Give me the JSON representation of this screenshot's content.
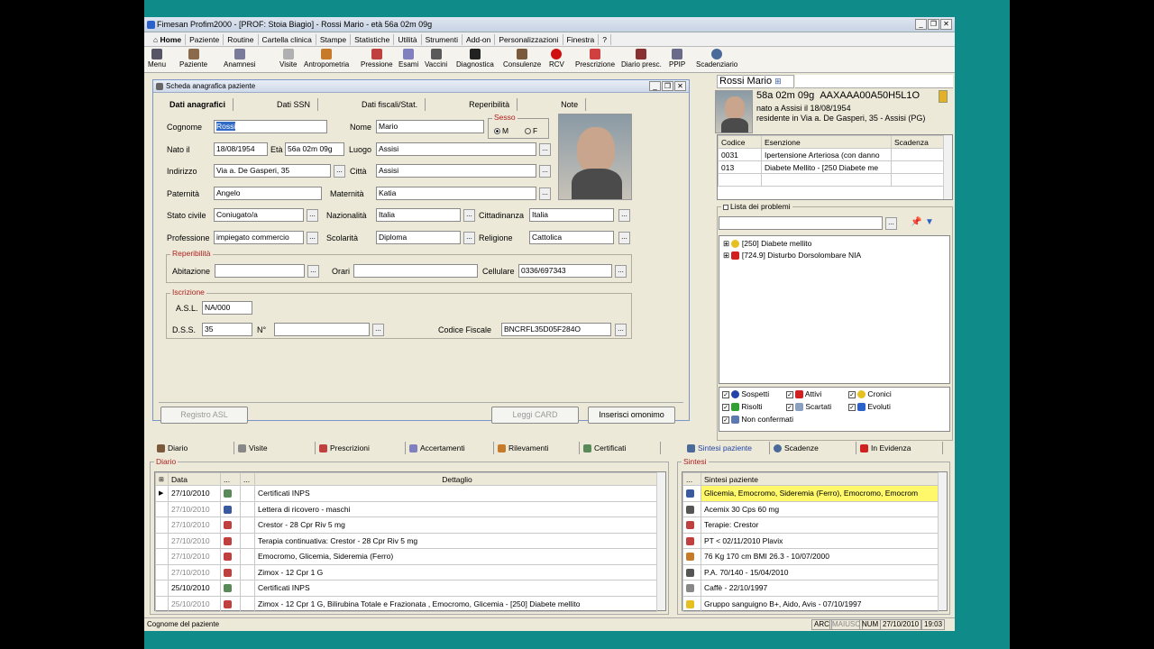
{
  "window": {
    "title": "Fimesan Profim2000 - [PROF: Stoia Biagio] - Rossi Mario - età 56a 02m 09g"
  },
  "menu": [
    "Home",
    "Paziente",
    "Routine",
    "Cartella clinica",
    "Stampe",
    "Statistiche",
    "Utilità",
    "Strumenti",
    "Add-on",
    "Personalizzazioni",
    "Finestra",
    "?"
  ],
  "toolbar": [
    "Menu",
    "Paziente",
    "Anamnesi",
    "Visite",
    "Antropometria",
    "Pressione",
    "Esami",
    "Vaccini",
    "Diagnostica",
    "Consulenze",
    "RCV",
    "Prescrizione",
    "Diario presc.",
    "PPIP",
    "Scadenziario"
  ],
  "form": {
    "title": "Scheda anagrafica paziente",
    "tabs": [
      "Dati anagrafici",
      "Dati SSN",
      "Dati fiscali/Stat.",
      "Reperibilità",
      "Note"
    ],
    "labels": {
      "cognome": "Cognome",
      "nome": "Nome",
      "sesso": "Sesso",
      "m": "M",
      "f": "F",
      "nato": "Nato il",
      "eta": "Età",
      "luogo": "Luogo",
      "indirizzo": "Indirizzo",
      "citta": "Città",
      "paternita": "Paternità",
      "maternita": "Maternità",
      "stato": "Stato civile",
      "naz": "Nazionalità",
      "citt": "Cittadinanza",
      "prof": "Professione",
      "scol": "Scolarità",
      "rel": "Religione",
      "reper": "Reperibilità",
      "abit": "Abitazione",
      "orari": "Orari",
      "cell": "Cellulare",
      "iscr": "Iscrizione",
      "asl": "A.S.L.",
      "dss": "D.S.S.",
      "n": "N°",
      "cf": "Codice Fiscale"
    },
    "values": {
      "cognome": "Rossi",
      "nome": "Mario",
      "nato": "18/08/1954",
      "eta": "56a 02m 09g",
      "luogo": "Assisi",
      "indirizzo": "Via a. De Gasperi, 35",
      "citta": "Assisi",
      "paternita": "Angelo",
      "maternita": "Katia",
      "stato": "Coniugato/a",
      "naz": "Italia",
      "citt": "Italia",
      "prof": "impiegato commercio",
      "scol": "Diploma",
      "rel": "Cattolica",
      "abit": "",
      "orari": "",
      "cell": "0336/697343",
      "asl": "NA/000",
      "dss": "35",
      "n": "",
      "cf": "BNCRFL35D05F284O"
    },
    "buttons": {
      "registro": "Registro ASL",
      "card": "Leggi CARD",
      "omonimo": "Inserisci omonimo"
    }
  },
  "patient": {
    "name": "Rossi Mario",
    "age": "58a 02m 09g",
    "code": "AAXAAA00A50H5L1O",
    "born": "nato a Assisi il 18/08/1954",
    "resid": "residente in Via a. De Gasperi, 35 - Assisi (PG)",
    "ex_headers": [
      "Codice",
      "Esenzione",
      "Scadenza"
    ],
    "exemptions": [
      [
        "0031",
        "Ipertensione Arteriosa (con danno",
        ""
      ],
      [
        "013",
        "Diabete Mellito - [250 Diabete me",
        ""
      ]
    ],
    "problems_title": "Lista dei problemi",
    "problems": [
      "[250] Diabete mellito",
      "[724.9] Disturbo Dorsolombare NIA"
    ],
    "filters": [
      "Sospetti",
      "Attivi",
      "Cronici",
      "Risolti",
      "Scartati",
      "Evoluti",
      "Non confermati"
    ]
  },
  "bottom_tabs": [
    "Diario",
    "Visite",
    "Prescrizioni",
    "Accertamenti",
    "Rilevamenti",
    "Certificati"
  ],
  "right_tabs": [
    "Sintesi paziente",
    "Scadenze",
    "In Evidenza"
  ],
  "diario": {
    "title": "Diario",
    "headers": [
      "Data",
      "...",
      "...",
      "Dettaglio"
    ],
    "rows": [
      [
        "27/10/2010",
        "Certificati INPS"
      ],
      [
        "27/10/2010",
        "Lettera di ricovero - maschi"
      ],
      [
        "27/10/2010",
        "Crestor - 28 Cpr Riv 5 mg"
      ],
      [
        "27/10/2010",
        "Terapia continuativa: Crestor - 28 Cpr Riv 5 mg"
      ],
      [
        "27/10/2010",
        "Emocromo, Glicemia, Sideremia (Ferro)"
      ],
      [
        "27/10/2010",
        "Zimox - 12 Cpr 1 G"
      ],
      [
        "25/10/2010",
        "Certificati INPS"
      ],
      [
        "25/10/2010",
        "Zimox - 12 Cpr 1 G, Bilirubina Totale e Frazionata , Emocromo, Glicemia - [250] Diabete mellito"
      ]
    ]
  },
  "sintesi": {
    "title": "Sintesi",
    "header": "Sintesi paziente",
    "rows": [
      "Glicemia, Emocromo, Sideremia (Ferro), Emocromo, Emocrom",
      "Acemix 30 Cps 60 mg",
      "Terapie: Crestor",
      "PT < 02/11/2010 Plavix",
      "76 Kg 170 cm BMI 26.3 - 10/07/2000",
      "P.A. 70/140 - 15/04/2010",
      "Caffè - 22/10/1997",
      "Gruppo sanguigno B+, Aido, Avis - 07/10/1997"
    ]
  },
  "status": {
    "left": "Cognome del paziente",
    "arc": "ARC",
    "maiusc": "MAIUSC",
    "num": "NUM",
    "date": "27/10/2010",
    "time": "19:03"
  }
}
